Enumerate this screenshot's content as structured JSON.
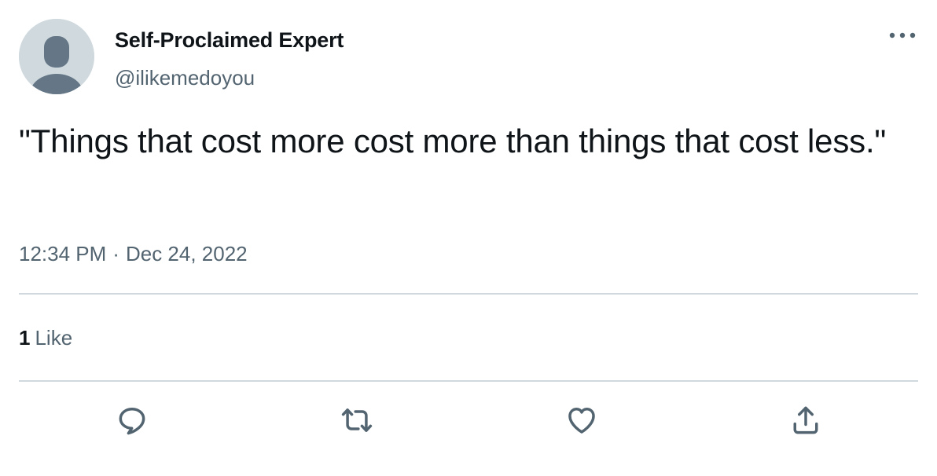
{
  "author": {
    "display_name": "Self-Proclaimed Expert",
    "handle": "@ilikemedoyou",
    "avatar_icon": "default-avatar-icon"
  },
  "tweet": {
    "text": "\"Things that cost more cost more than things that cost less.\"",
    "time": "12:34 PM",
    "separator": "·",
    "date": "Dec 24, 2022"
  },
  "stats": {
    "likes_count": "1",
    "likes_label": "Like"
  },
  "actions": [
    {
      "name": "reply",
      "icon": "reply-icon"
    },
    {
      "name": "retweet",
      "icon": "retweet-icon"
    },
    {
      "name": "like",
      "icon": "heart-icon"
    },
    {
      "name": "share",
      "icon": "share-icon"
    }
  ],
  "colors": {
    "text_primary": "#0f1419",
    "text_secondary": "#536471",
    "divider": "#cfd9de",
    "avatar_bg": "#cfd9de",
    "avatar_fg": "#657786"
  }
}
